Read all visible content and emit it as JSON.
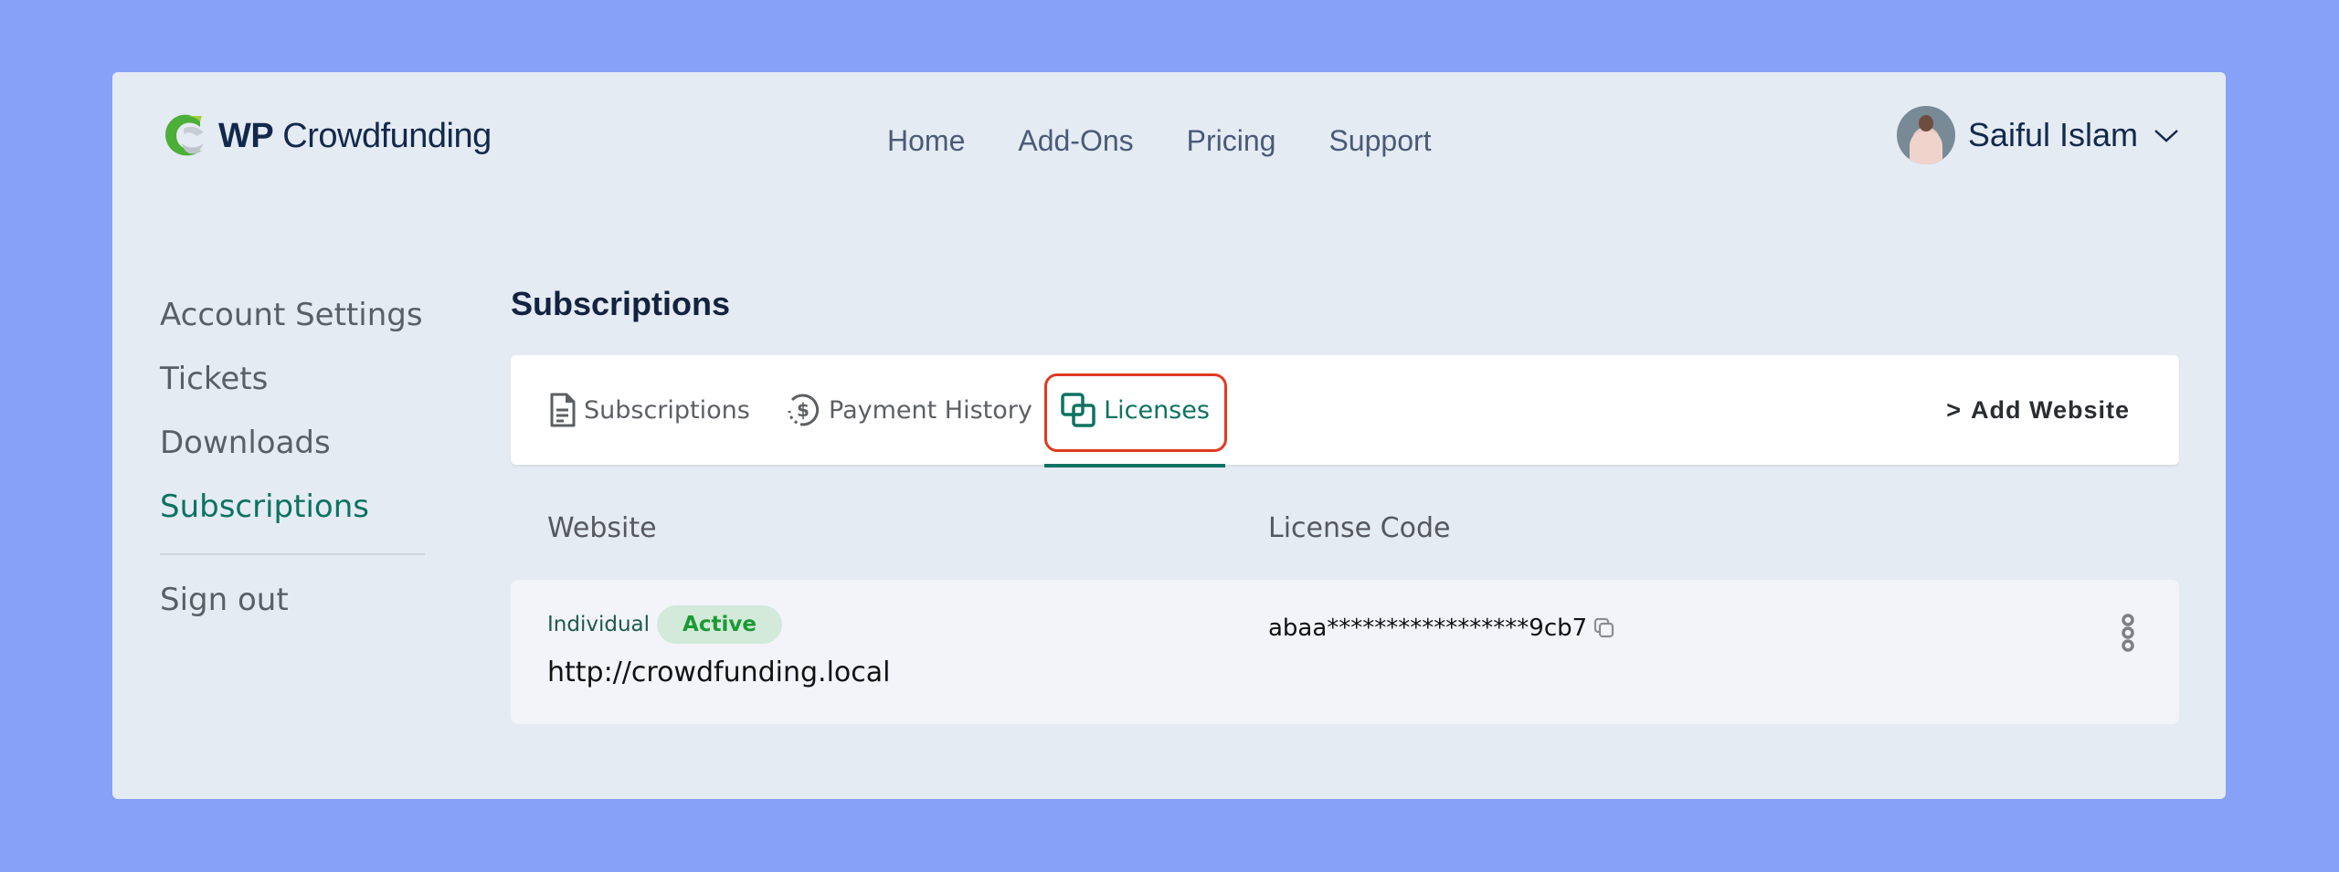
{
  "brand": {
    "name_bold": "WP",
    "name_light": "Crowdfunding",
    "logo_icon": "crowdfunding-logo-icon"
  },
  "nav": {
    "items": [
      {
        "label": "Home"
      },
      {
        "label": "Add-Ons"
      },
      {
        "label": "Pricing"
      },
      {
        "label": "Support"
      }
    ]
  },
  "user": {
    "name": "Saiful Islam",
    "menu_icon": "chevron-down-icon"
  },
  "sidebar": {
    "items": [
      {
        "label": "Account Settings",
        "active": false
      },
      {
        "label": "Tickets",
        "active": false
      },
      {
        "label": "Downloads",
        "active": false
      },
      {
        "label": "Subscriptions",
        "active": true
      }
    ],
    "signout_label": "Sign out"
  },
  "page": {
    "title": "Subscriptions"
  },
  "tabs": [
    {
      "label": "Subscriptions",
      "icon": "document-icon",
      "active": false
    },
    {
      "label": "Payment History",
      "icon": "dollar-circle-icon",
      "active": false
    },
    {
      "label": "Licenses",
      "icon": "licenses-icon",
      "active": true
    }
  ],
  "actions": {
    "add_website_label": "Add Website",
    "add_website_prefix": ">"
  },
  "table": {
    "columns": [
      "Website",
      "License Code"
    ],
    "rows": [
      {
        "plan": "Individual",
        "status": "Active",
        "website": "http://crowdfunding.local",
        "license_code": "abaa*****************9cb7"
      }
    ]
  },
  "colors": {
    "background": "#86a1f7",
    "card": "#e4ebf3",
    "accent": "#0d7261",
    "highlight": "#e03a22",
    "active_badge_bg": "#d3e9d9",
    "active_badge_text": "#1a9a34"
  }
}
